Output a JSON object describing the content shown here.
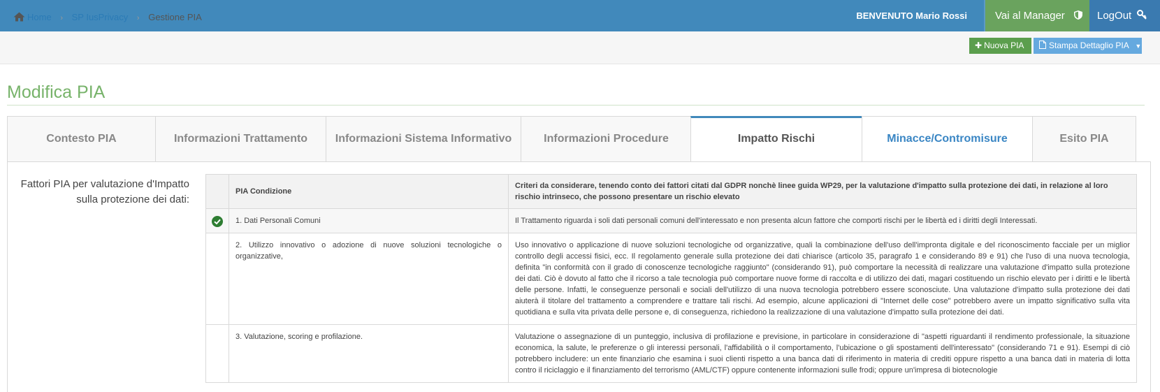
{
  "topbar": {
    "welcome": "BENVENUTO Mario Rossi",
    "manager_label": "Vai al Manager",
    "logout_label": "LogOut",
    "bg": "#4189bb",
    "manager_bg": "#6aa35e"
  },
  "breadcrumb": {
    "home": "Home",
    "section": "SP IusPrivacy",
    "current": "Gestione PIA"
  },
  "actions": {
    "new_label": "Nuova PIA",
    "print_label": "Stampa Dettaglio PIA"
  },
  "page": {
    "title": "Modifica PIA"
  },
  "tabs": [
    {
      "label": "Contesto PIA"
    },
    {
      "label": "Informazioni Trattamento"
    },
    {
      "label": "Informazioni Sistema Informativo"
    },
    {
      "label": "Informazioni Procedure"
    },
    {
      "label": "Impatto Rischi"
    },
    {
      "label": "Minacce/Contromisure"
    },
    {
      "label": "Esito PIA"
    }
  ],
  "section": {
    "label": "Fattori PIA per valutazione d'Impatto sulla protezione dei dati:"
  },
  "table": {
    "headers": {
      "condition": "PIA Condizione",
      "criteria": "Criteri da considerare, tenendo conto dei fattori citati dal GDPR nonchè linee guida WP29, per la valutazione d'impatto sulla protezione dei dati, in relazione al loro rischio intrinseco, che possono presentare un rischio elevato"
    },
    "rows": [
      {
        "checked": true,
        "condition": "1. Dati Personali Comuni",
        "criteria": "Il Trattamento riguarda i soli dati personali comuni dell'interessato e non presenta alcun fattore che comporti rischi per le libertà ed i diritti degli Interessati."
      },
      {
        "checked": false,
        "condition": "2. Utilizzo innovativo o adozione di nuove soluzioni tecnologiche o organizzative,",
        "criteria": "Uso innovativo o applicazione di nuove soluzioni tecnologiche od organizzative, quali la combinazione dell'uso dell'impronta digitale e del riconoscimento facciale per un miglior controllo degli accessi fisici, ecc. Il regolamento generale sulla protezione dei dati chiarisce (articolo 35, paragrafo 1 e considerando 89 e 91) che l'uso di una nuova tecnologia, definita \"in conformità con il grado di conoscenze tecnologiche raggiunto\" (considerando 91), può comportare la necessità di realizzare una valutazione d'impatto sulla protezione dei dati. Ciò è dovuto al fatto che il ricorso a tale tecnologia può comportare nuove forme di raccolta e di utilizzo dei dati, magari costituendo un rischio elevato per i diritti e le libertà delle persone. Infatti, le conseguenze personali e sociali dell'utilizzo di una nuova tecnologia potrebbero essere sconosciute. Una valutazione d'impatto sulla protezione dei dati aiuterà il titolare del trattamento a comprendere e trattare tali rischi. Ad esempio, alcune applicazioni di \"Internet delle cose\" potrebbero avere un impatto significativo sulla vita quotidiana e sulla vita privata delle persone e, di conseguenza, richiedono la realizzazione di una valutazione d'impatto sulla protezione dei dati."
      },
      {
        "checked": false,
        "condition": "3. Valutazione, scoring e profilazione.",
        "criteria": "Valutazione o assegnazione di un punteggio, inclusiva di profilazione e previsione, in particolare in considerazione di \"aspetti riguardanti il rendimento professionale, la situazione economica, la salute, le preferenze o gli interessi personali, l'affidabilità o il comportamento, l'ubicazione o gli spostamenti dell'interessato\" (considerando 71 e 91). Esempi di ciò potrebbero includere: un ente finanziario che esamina i suoi clienti rispetto a una banca dati di riferimento in materia di crediti oppure rispetto a una banca dati in materia di lotta contro il riciclaggio e il finanziamento del terrorismo (AML/CTF) oppure contenente informazioni sulle frodi; oppure un'impresa di biotecnologie"
      }
    ]
  }
}
